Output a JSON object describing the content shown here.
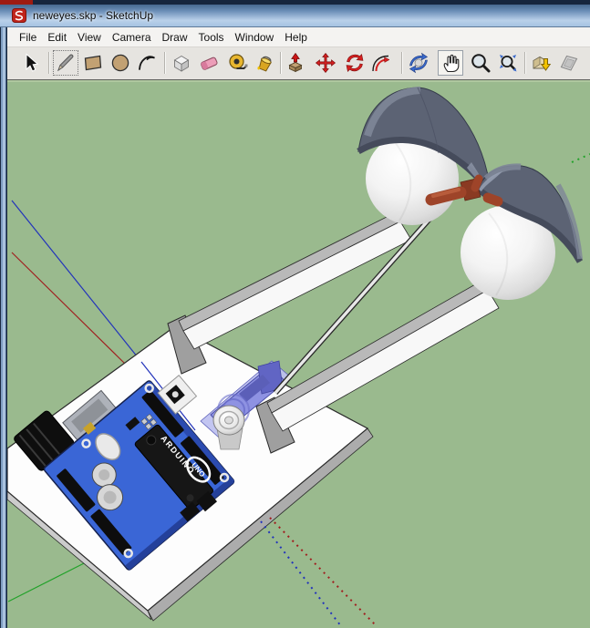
{
  "window": {
    "title": "neweyes.skp - SketchUp",
    "icon": "sketchup-logo"
  },
  "menu": {
    "items": [
      {
        "label": "File"
      },
      {
        "label": "Edit"
      },
      {
        "label": "View"
      },
      {
        "label": "Camera"
      },
      {
        "label": "Draw"
      },
      {
        "label": "Tools"
      },
      {
        "label": "Window"
      },
      {
        "label": "Help"
      }
    ]
  },
  "toolbar": {
    "tools": [
      {
        "name": "Select"
      },
      {
        "name": "Line"
      },
      {
        "name": "Rectangle"
      },
      {
        "name": "Circle"
      },
      {
        "name": "Arc"
      },
      {
        "name": "Make Component"
      },
      {
        "name": "Eraser"
      },
      {
        "name": "Tape Measure"
      },
      {
        "name": "Paint Bucket"
      },
      {
        "name": "Push/Pull"
      },
      {
        "name": "Move"
      },
      {
        "name": "Rotate"
      },
      {
        "name": "Offset"
      },
      {
        "name": "Orbit"
      },
      {
        "name": "Pan"
      },
      {
        "name": "Zoom"
      },
      {
        "name": "Zoom Extents"
      },
      {
        "name": "Get Models"
      },
      {
        "name": "Share Model"
      }
    ]
  },
  "viewport": {
    "background_color": "#9ABA8E",
    "axis_colors": {
      "red": "#A02020",
      "green": "#22A22A",
      "blue": "#2233BB"
    },
    "model": {
      "board_label": "ARDUINO",
      "board_badge": "UNO",
      "board_color": "#3A66D6",
      "eyeball_color": "#F2F2F2",
      "eyelid_color": "#5C6374",
      "servo_color": "#8E92E2",
      "linkage_color": "#9E4429",
      "plate_color": "#FDFDFD"
    }
  }
}
